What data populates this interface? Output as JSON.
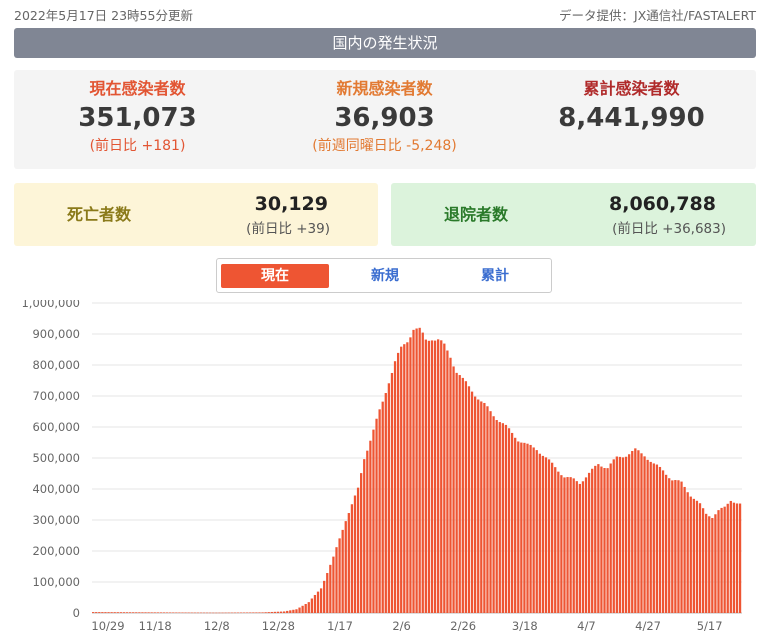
{
  "header": {
    "updated": "2022年5月17日 23時55分更新",
    "source": "データ提供：JX通信社/FASTALERT",
    "banner": "国内の発生状況"
  },
  "stats": {
    "current": {
      "label": "現在感染者数",
      "value": "351,073",
      "sub": "(前日比 +181)"
    },
    "new": {
      "label": "新規感染者数",
      "value": "36,903",
      "sub": "(前週同曜日比 -5,248)"
    },
    "total": {
      "label": "累計感染者数",
      "value": "8,441,990"
    }
  },
  "deaths": {
    "label": "死亡者数",
    "value": "30,129",
    "sub": "(前日比 +39)"
  },
  "recovered": {
    "label": "退院者数",
    "value": "8,060,788",
    "sub": "(前日比 +36,683)"
  },
  "tabs": [
    "現在",
    "新規",
    "累計"
  ],
  "active_tab": 0,
  "colors": {
    "bar": "#ee5533",
    "label_current": "#e25533",
    "label_new": "#e27a33",
    "label_total": "#b02a2a",
    "deaths_bg": "#fdf5d8",
    "deaths_label": "#8a7a1a",
    "recovered_bg": "#dcf3dc",
    "recovered_label": "#2a7a2a"
  },
  "chart_data": {
    "type": "bar",
    "y_ticks": [
      "0",
      "100,000",
      "200,000",
      "300,000",
      "400,000",
      "500,000",
      "600,000",
      "700,000",
      "800,000",
      "900,000",
      "1,000,000"
    ],
    "ylim": [
      0,
      1000000
    ],
    "x_tick_labels": [
      "10/29",
      "11/18",
      "12/8",
      "12/28",
      "1/17",
      "2/6",
      "2/26",
      "3/18",
      "4/7",
      "4/27",
      "5/17"
    ],
    "x_tick_days": [
      0,
      20,
      40,
      60,
      80,
      100,
      120,
      140,
      160,
      180,
      200
    ],
    "key_points": [
      [
        0,
        3000
      ],
      [
        20,
        2000
      ],
      [
        40,
        1000
      ],
      [
        55,
        2000
      ],
      [
        62,
        5000
      ],
      [
        66,
        12000
      ],
      [
        70,
        35000
      ],
      [
        74,
        80000
      ],
      [
        78,
        180000
      ],
      [
        82,
        300000
      ],
      [
        86,
        400000
      ],
      [
        88,
        500000
      ],
      [
        90,
        560000
      ],
      [
        92,
        620000
      ],
      [
        94,
        680000
      ],
      [
        96,
        750000
      ],
      [
        98,
        810000
      ],
      [
        100,
        850000
      ],
      [
        102,
        880000
      ],
      [
        104,
        920000
      ],
      [
        106,
        910000
      ],
      [
        108,
        880000
      ],
      [
        110,
        890000
      ],
      [
        112,
        880000
      ],
      [
        114,
        860000
      ],
      [
        116,
        830000
      ],
      [
        118,
        780000
      ],
      [
        120,
        750000
      ],
      [
        123,
        720000
      ],
      [
        126,
        680000
      ],
      [
        129,
        650000
      ],
      [
        132,
        620000
      ],
      [
        135,
        590000
      ],
      [
        138,
        560000
      ],
      [
        141,
        540000
      ],
      [
        144,
        530000
      ],
      [
        147,
        500000
      ],
      [
        150,
        470000
      ],
      [
        153,
        440000
      ],
      [
        156,
        430000
      ],
      [
        158,
        420000
      ],
      [
        161,
        450000
      ],
      [
        164,
        480000
      ],
      [
        167,
        470000
      ],
      [
        170,
        500000
      ],
      [
        173,
        510000
      ],
      [
        176,
        525000
      ],
      [
        179,
        510000
      ],
      [
        182,
        480000
      ],
      [
        185,
        460000
      ],
      [
        188,
        430000
      ],
      [
        191,
        420000
      ],
      [
        194,
        380000
      ],
      [
        197,
        350000
      ],
      [
        199,
        320000
      ],
      [
        201,
        310000
      ],
      [
        203,
        330000
      ],
      [
        205,
        340000
      ],
      [
        207,
        365000
      ],
      [
        209,
        355000
      ],
      [
        210,
        351073
      ]
    ]
  }
}
